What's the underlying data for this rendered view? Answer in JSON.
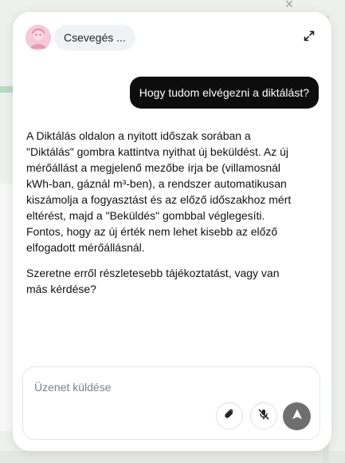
{
  "chat": {
    "title": "Csevegés ...",
    "user_message": "Hogy tudom elvégezni a diktálást?",
    "assistant_paragraphs": [
      "A Diktálás oldalon a nyitott időszak sorában a \"Diktálás\" gombra kattintva nyithat új beküldést. Az új mérőállást a megjelenő mezőbe írja be (villamosnál kWh-ban, gáznál m³-ben), a rendszer automatikusan kiszámolja a fogyasztást és az előző időszakhoz mért eltérést, majd a \"Beküldés\" gombbal véglegesíti. Fontos, hogy az új érték nem lehet kisebb az előző elfogadott mérőállásnál.",
      "Szeretne erről részletesebb tájékoztatást, vagy van más kérdése?"
    ]
  },
  "composer": {
    "placeholder": "Üzenet küldése"
  },
  "icons": {
    "avatar": "avatar-icon",
    "expand": "expand-icon",
    "attach": "paperclip-icon",
    "mic": "microphone-off-icon",
    "send": "send-arrow-icon",
    "close": "close-icon"
  },
  "colors": {
    "user_bubble": "#0d0d0d",
    "send_button": "#6f6f6f",
    "panel": "#ffffff"
  }
}
